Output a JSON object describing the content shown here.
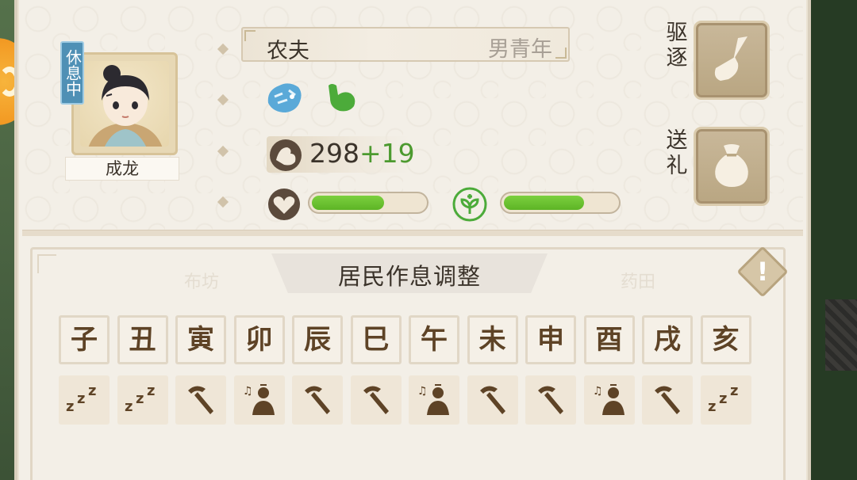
{
  "resident": {
    "status": "休息中",
    "name": "成龙",
    "occupation": "农夫",
    "age_group": "男青年",
    "traits": [
      "tiger-icon",
      "strength-icon"
    ],
    "power_base": "298",
    "power_bonus": "+19",
    "health_level": 0.65,
    "mood_level": 0.72
  },
  "actions": {
    "expel_label": "驱逐",
    "gift_label": "送礼"
  },
  "schedule": {
    "title": "居民作息调整",
    "hours": [
      "子",
      "丑",
      "寅",
      "卯",
      "辰",
      "巳",
      "午",
      "未",
      "申",
      "酉",
      "戌",
      "亥"
    ],
    "activities": [
      "sleep",
      "sleep",
      "work",
      "leisure",
      "work",
      "work",
      "leisure",
      "work",
      "work",
      "leisure",
      "work",
      "sleep"
    ]
  },
  "background_labels": [
    "布坊",
    "药田"
  ],
  "colors": {
    "panel": "#f3efe7",
    "accent_green": "#5db425",
    "status_blue": "#4f90b5",
    "glyph_brown": "#5e4326"
  }
}
